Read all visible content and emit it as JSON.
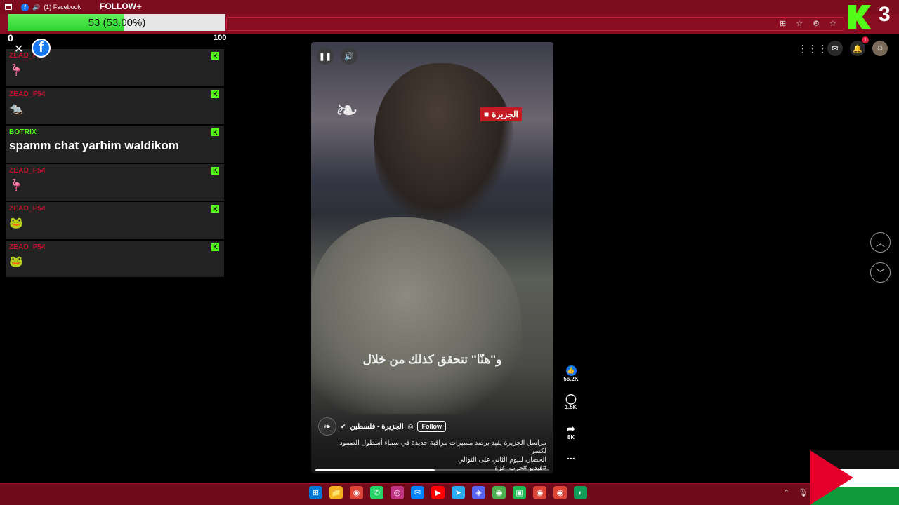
{
  "browser": {
    "tab_label": "(1) Facebook",
    "follow_label": "FOLLOW",
    "plus_label": "+"
  },
  "goal": {
    "value": 53,
    "percent": 53.0,
    "label": "53 (53.00%)",
    "min_label": "0",
    "max_label": "100",
    "fill_color": "#2bd42f"
  },
  "kick": {
    "viewer_count": "3",
    "brand_color": "#53fc18"
  },
  "chat": {
    "close_icon": "close-icon",
    "platform_icon": "facebook-icon",
    "messages": [
      {
        "user": "ZEAD_F54",
        "user_color": "#c8102e",
        "content": "🦩",
        "type": "emote"
      },
      {
        "user": "ZEAD_F54",
        "user_color": "#c8102e",
        "content": "🐀",
        "type": "emote"
      },
      {
        "user": "BOTRIX",
        "user_color": "#53fc18",
        "content": "spamm chat yarhim waldikom",
        "type": "text"
      },
      {
        "user": "ZEAD_F54",
        "user_color": "#c8102e",
        "content": "🦩",
        "type": "emote"
      },
      {
        "user": "ZEAD_F54",
        "user_color": "#c8102e",
        "content": "🐸",
        "type": "emote"
      },
      {
        "user": "ZEAD_F54",
        "user_color": "#c8102e",
        "content": "🐸",
        "type": "emote"
      }
    ]
  },
  "video": {
    "pause_icon": "pause-icon",
    "volume_icon": "volume-icon",
    "logo_text": "الجزيرة",
    "caption": "و\"هنّا\" تتحقق كذلك من خلال",
    "author_name": "الجزيرة - فلسطين",
    "follow_label": "Follow",
    "description_line1": "مراسل الجزيرة يفيد برصد مسيرات مراقبة جديدة في سماء أسطول الصمود لكسر",
    "description_line2": "الحصار، لليوم الثاني على التوالي",
    "hashtags": "#فيديو #حرب_غزة",
    "progress_fraction": 0.51
  },
  "reactions": {
    "likes": "56.2K",
    "comments": "1.5K",
    "shares": "8K",
    "more_label": "..."
  },
  "header_icons": {
    "notification_count": "1"
  },
  "taskbar": {
    "icons": [
      "windows-icon",
      "file-explorer-icon",
      "chrome-icon",
      "whatsapp-icon",
      "instagram-icon",
      "messenger-icon",
      "youtube-icon",
      "telegram-icon",
      "discord-icon",
      "chrome-profile-icon",
      "capcut-icon",
      "chrome-icon",
      "chrome-icon",
      "edge-icon"
    ]
  }
}
